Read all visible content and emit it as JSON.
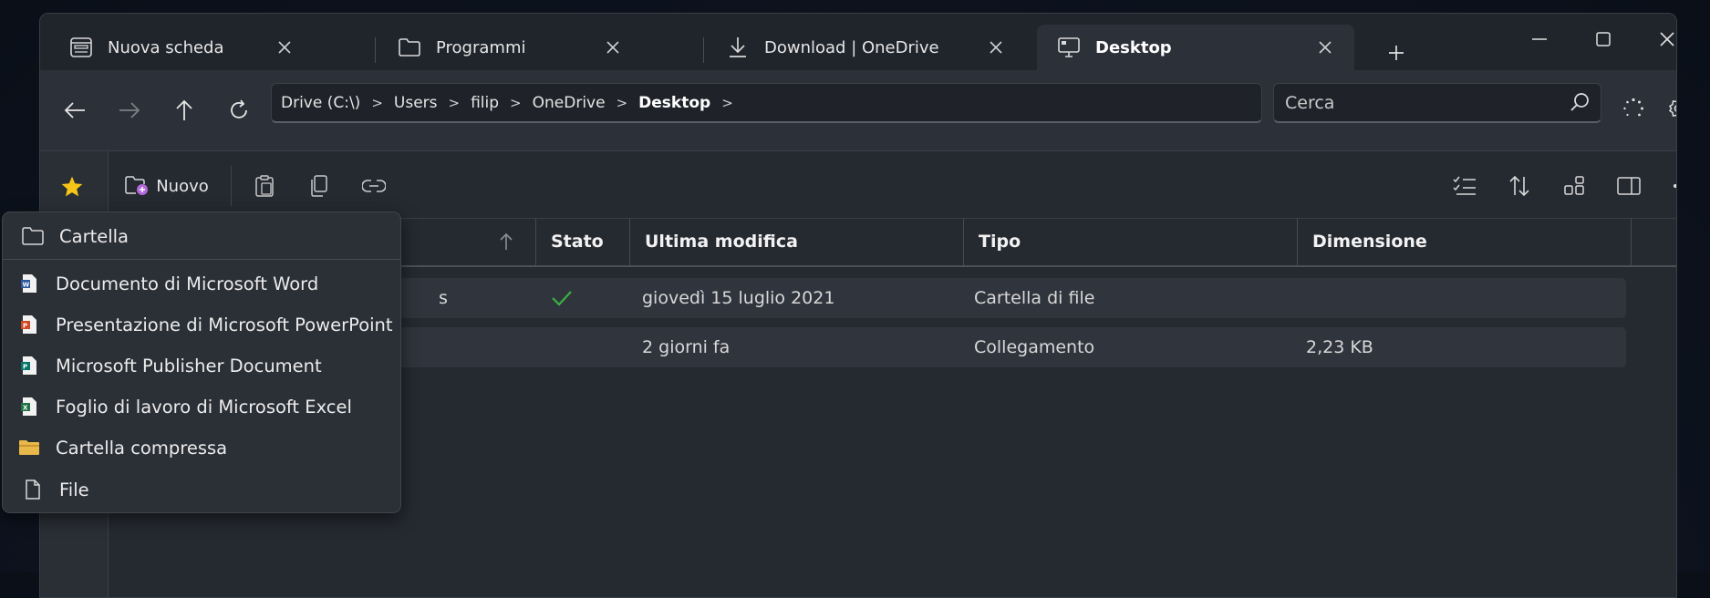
{
  "tabs": [
    {
      "label": "Nuova scheda",
      "icon": "newtab-icon"
    },
    {
      "label": "Programmi",
      "icon": "folder-icon"
    },
    {
      "label": "Download | OneDrive",
      "icon": "download-icon"
    },
    {
      "label": "Desktop",
      "icon": "desktop-icon",
      "active": true
    }
  ],
  "address": {
    "crumbs": [
      "Drive (C:\\)",
      "Users",
      "filip",
      "OneDrive",
      "Desktop"
    ]
  },
  "search": {
    "placeholder": "Cerca"
  },
  "toolbar": {
    "new_label": "Nuovo"
  },
  "columns": [
    "Stato",
    "Ultima modifica",
    "Tipo",
    "Dimensione"
  ],
  "rows": [
    {
      "name_fragment": "s",
      "status": "synced",
      "modified": "giovedì 15 luglio 2021",
      "type": "Cartella di file",
      "size": ""
    },
    {
      "name_fragment": "",
      "status": "",
      "modified": "2 giorni fa",
      "type": "Collegamento",
      "size": "2,23 KB"
    }
  ],
  "new_menu": {
    "items": [
      {
        "label": "Cartella",
        "icon": "folder-icon"
      },
      {
        "label": "Documento di Microsoft Word",
        "icon": "word-icon"
      },
      {
        "label": "Presentazione di Microsoft PowerPoint",
        "icon": "powerpoint-icon"
      },
      {
        "label": "Microsoft Publisher Document",
        "icon": "publisher-icon"
      },
      {
        "label": "Foglio di lavoro di Microsoft Excel",
        "icon": "excel-icon"
      },
      {
        "label": "Cartella compressa",
        "icon": "zip-folder-icon"
      },
      {
        "label": "File",
        "icon": "file-icon"
      }
    ]
  },
  "colors": {
    "accent_star": "#f5c518",
    "check": "#3cb043",
    "word": "#2b579a",
    "powerpoint": "#d24726",
    "publisher": "#077568",
    "excel": "#217346",
    "zip": "#e8b84a"
  }
}
